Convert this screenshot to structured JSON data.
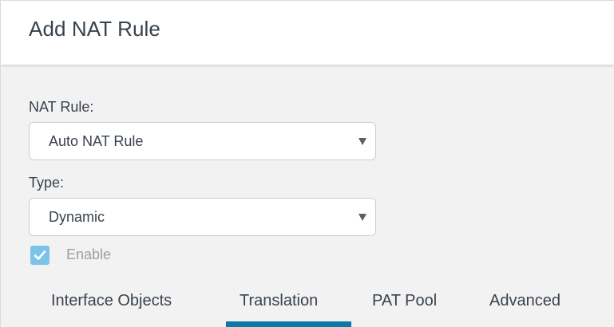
{
  "dialog": {
    "title": "Add NAT Rule"
  },
  "nat_rule": {
    "label": "NAT Rule:",
    "selected": "Auto NAT Rule"
  },
  "type": {
    "label": "Type:",
    "selected": "Dynamic"
  },
  "enable": {
    "label": "Enable",
    "checked": true
  },
  "tabs": [
    {
      "label": "Interface Objects",
      "active": false
    },
    {
      "label": "Translation",
      "active": true
    },
    {
      "label": "PAT Pool",
      "active": false
    },
    {
      "label": "Advanced",
      "active": false
    }
  ],
  "colors": {
    "accent": "#0a79a8",
    "checkbox": "#7cc3e8",
    "text": "#39424c",
    "muted_text": "#9aa1a8",
    "panel_background": "#f2f2f2"
  },
  "icons": {
    "dropdown": "chevron-down-icon",
    "checkbox": "check-icon"
  }
}
